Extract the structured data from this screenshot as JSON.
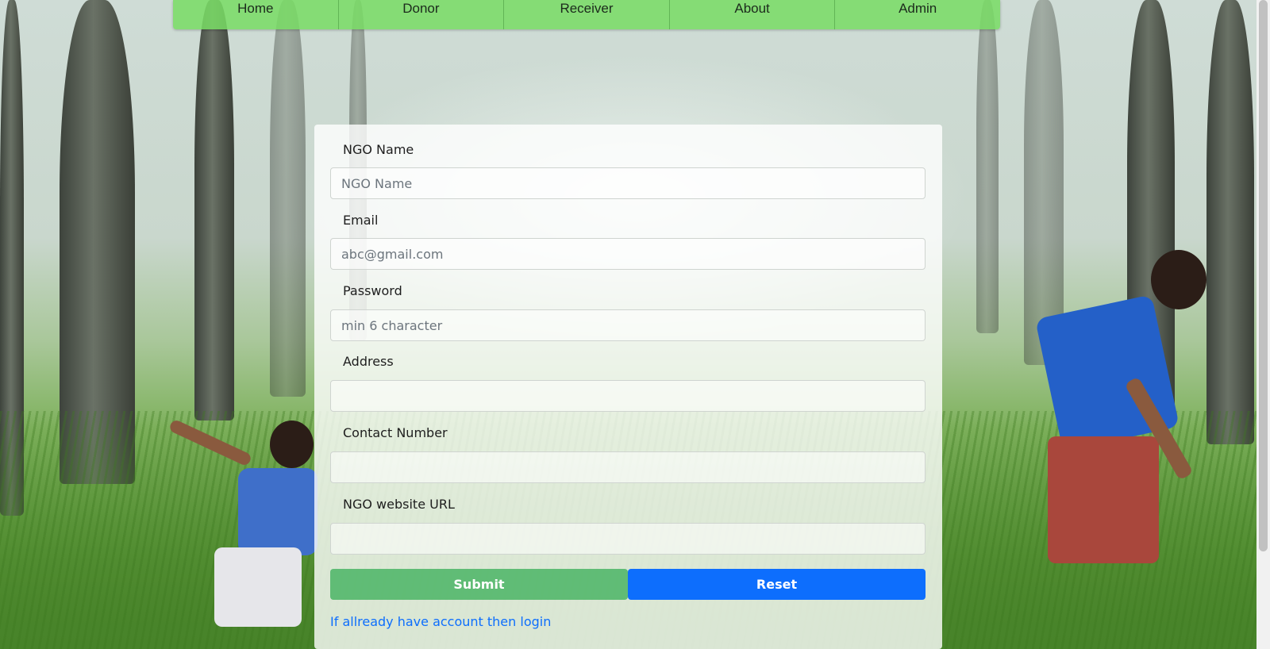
{
  "nav": {
    "items": [
      {
        "label": "Home"
      },
      {
        "label": "Donor"
      },
      {
        "label": "Receiver"
      },
      {
        "label": "About"
      },
      {
        "label": "Admin"
      }
    ]
  },
  "form": {
    "fields": [
      {
        "label": "NGO Name",
        "placeholder": "NGO Name",
        "value": ""
      },
      {
        "label": "Email",
        "placeholder": "abc@gmail.com",
        "value": ""
      },
      {
        "label": "Password",
        "placeholder": "min 6 character",
        "value": ""
      },
      {
        "label": "Address",
        "placeholder": "",
        "value": ""
      },
      {
        "label": "Contact Number",
        "placeholder": "",
        "value": ""
      },
      {
        "label": "NGO website URL",
        "placeholder": "",
        "value": ""
      }
    ],
    "submit_label": "Submit",
    "reset_label": "Reset",
    "login_link": "If allready have account then login"
  },
  "colors": {
    "nav_bg": "#78dc64",
    "submit_bg": "#44b260",
    "reset_bg": "#0d6efd",
    "link": "#0d6efd"
  }
}
